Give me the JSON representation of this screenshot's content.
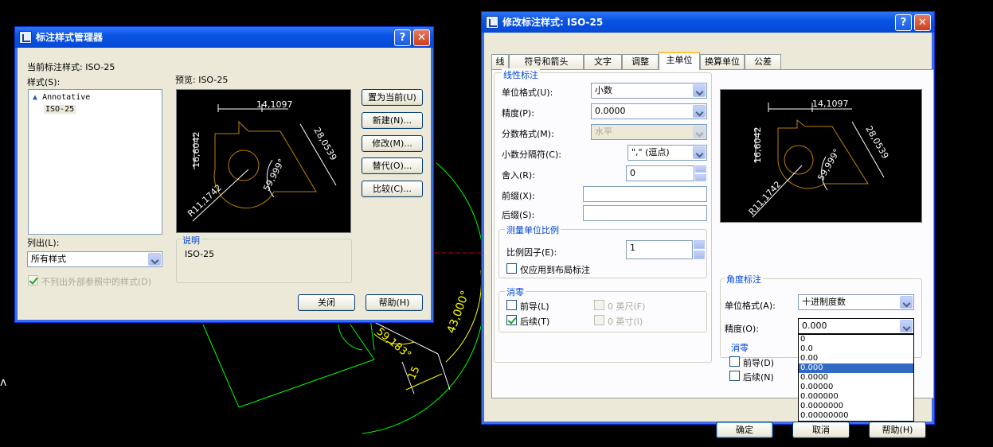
{
  "background": {
    "dims": [
      "15",
      "43,000°",
      "59,183°"
    ]
  },
  "manager": {
    "title": "标注样式管理器",
    "current_style_label": "当前标注样式: ISO-25",
    "styles_label": "样式(S):",
    "styles": [
      "Annotative",
      "ISO-25"
    ],
    "preview_label": "预览: ISO-25",
    "list_label": "列出(L):",
    "list_value": "所有样式",
    "exclude_xref_label": "不列出外部参照中的样式(D)",
    "description_title": "说明",
    "description_text": "ISO-25",
    "buttons": {
      "set_current": "置为当前(U)",
      "new": "新建(N)...",
      "modify": "修改(M)...",
      "override": "替代(O)...",
      "compare": "比较(C)...",
      "close": "关闭",
      "help": "帮助(H)"
    }
  },
  "modify": {
    "title": "修改标注样式: ISO-25",
    "tabs": [
      "线",
      "符号和箭头",
      "文字",
      "调整",
      "主单位",
      "换算单位",
      "公差"
    ],
    "active_tab": "主单位",
    "linear": {
      "title": "线性标注",
      "unit_format_label": "单位格式(U):",
      "unit_format_value": "小数",
      "precision_label": "精度(P):",
      "precision_value": "0.0000",
      "fraction_format_label": "分数格式(M):",
      "fraction_format_value": "水平",
      "decimal_sep_label": "小数分隔符(C):",
      "decimal_sep_value": "\",\" (逗点)",
      "round_off_label": "舍入(R):",
      "round_off_value": "0",
      "prefix_label": "前缀(X):",
      "suffix_label": "后缀(S):"
    },
    "scale": {
      "title": "测量单位比例",
      "factor_label": "比例因子(E):",
      "factor_value": "1",
      "layout_only_label": "仅应用到布局标注"
    },
    "zero_linear": {
      "title": "消零",
      "leading_label": "前导(L)",
      "trailing_label": "后续(T)",
      "feet_label": "0 英尺(F)",
      "inches_label": "0 英寸(I)",
      "trailing_checked": true
    },
    "angular": {
      "title": "角度标注",
      "unit_format_label": "单位格式(A):",
      "unit_format_value": "十进制度数",
      "precision_label": "精度(O):",
      "precision_value": "0.000",
      "precision_options": [
        "0",
        "0.0",
        "0.00",
        "0.000",
        "0.0000",
        "0.00000",
        "0.000000",
        "0.0000000",
        "0.00000000"
      ],
      "precision_selected_index": 3
    },
    "zero_angular": {
      "title": "消零",
      "leading_label": "前导(D)",
      "trailing_label": "后续(N)"
    },
    "buttons": {
      "ok": "确定",
      "cancel": "取消",
      "help": "帮助(H)"
    }
  },
  "preview_dims": {
    "width": "14,1097",
    "height": "16,6042",
    "diagonal": "28,0539",
    "angle": "59,999°",
    "radius": "R11,1742"
  },
  "colors": {
    "titlebar": "#0a55e4",
    "dialog_face": "#ece9d8",
    "group_title": "#0046d5",
    "selection": "#316ac5",
    "cad_green": "#00ff00",
    "cad_yellow": "#ffff00",
    "cad_orange": "#c08000"
  }
}
